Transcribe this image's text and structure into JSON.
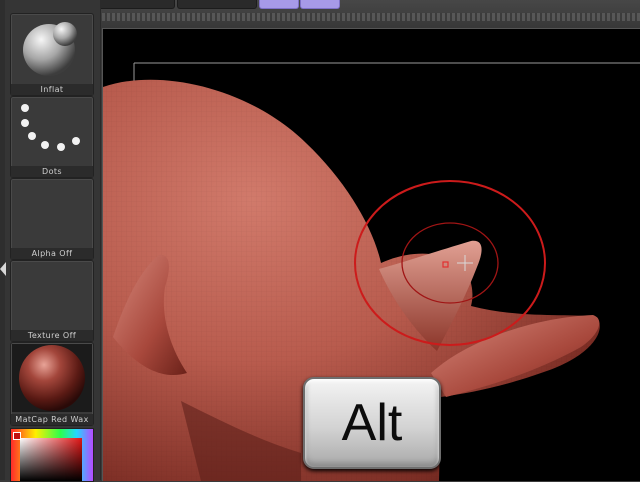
{
  "top_toolbar": {
    "faded_items": [
      "",
      "",
      ""
    ]
  },
  "sidebar": {
    "tiles": [
      {
        "label": "Inflat",
        "icon": "brush-sphere-icon"
      },
      {
        "label": "Dots",
        "icon": "stroke-dots-icon"
      },
      {
        "label": "Alpha  Off",
        "icon": "alpha-empty-icon"
      },
      {
        "label": "Texture  Off",
        "icon": "texture-empty-icon"
      },
      {
        "label": "MatCap  Red  Wax",
        "icon": "material-sphere-icon"
      }
    ]
  },
  "viewport": {
    "key_overlay": "Alt"
  },
  "colors": {
    "accent_purple": "#a79ae8",
    "model_red": "#b0554a",
    "brush_ring": "#cc1b1b"
  }
}
